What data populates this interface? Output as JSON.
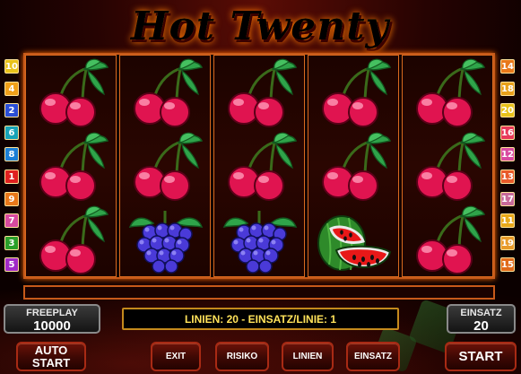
{
  "game": {
    "title": "Hot Twenty"
  },
  "paylines": {
    "left": [
      {
        "n": "10",
        "color": "#e8c21a"
      },
      {
        "n": "4",
        "color": "#f0a01a"
      },
      {
        "n": "2",
        "color": "#2a4ed8"
      },
      {
        "n": "6",
        "color": "#17a3b8"
      },
      {
        "n": "8",
        "color": "#1c7fd6"
      },
      {
        "n": "1",
        "color": "#e02020"
      },
      {
        "n": "9",
        "color": "#e8781a"
      },
      {
        "n": "7",
        "color": "#d84aa0"
      },
      {
        "n": "3",
        "color": "#2aa02a"
      },
      {
        "n": "5",
        "color": "#a02ac8"
      }
    ],
    "right": [
      {
        "n": "14",
        "color": "#e8781a"
      },
      {
        "n": "18",
        "color": "#e8a01a"
      },
      {
        "n": "20",
        "color": "#e8c21a"
      },
      {
        "n": "16",
        "color": "#e83a5a"
      },
      {
        "n": "12",
        "color": "#d84aa0"
      },
      {
        "n": "13",
        "color": "#e85a2a"
      },
      {
        "n": "17",
        "color": "#c86a9a"
      },
      {
        "n": "11",
        "color": "#e8a81a"
      },
      {
        "n": "19",
        "color": "#e89a2a"
      },
      {
        "n": "15",
        "color": "#e06a1a"
      }
    ]
  },
  "reels": [
    [
      "cherry",
      "cherry",
      "cherry"
    ],
    [
      "cherry",
      "cherry",
      "grapes"
    ],
    [
      "cherry",
      "cherry",
      "grapes"
    ],
    [
      "cherry",
      "cherry",
      "watermelon"
    ],
    [
      "cherry",
      "cherry",
      "cherry"
    ]
  ],
  "freeplay": {
    "label": "FREEPLAY",
    "value": "10000"
  },
  "einsatz_panel": {
    "label": "EINSATZ",
    "value": "20"
  },
  "info_line": "LINIEN: 20  -  EINSATZ/LINIE: 1",
  "buttons": {
    "autostart": "AUTO START",
    "exit": "EXIT",
    "risiko": "RISIKO",
    "linien": "LINIEN",
    "einsatz": "EINSATZ",
    "start": "START"
  }
}
